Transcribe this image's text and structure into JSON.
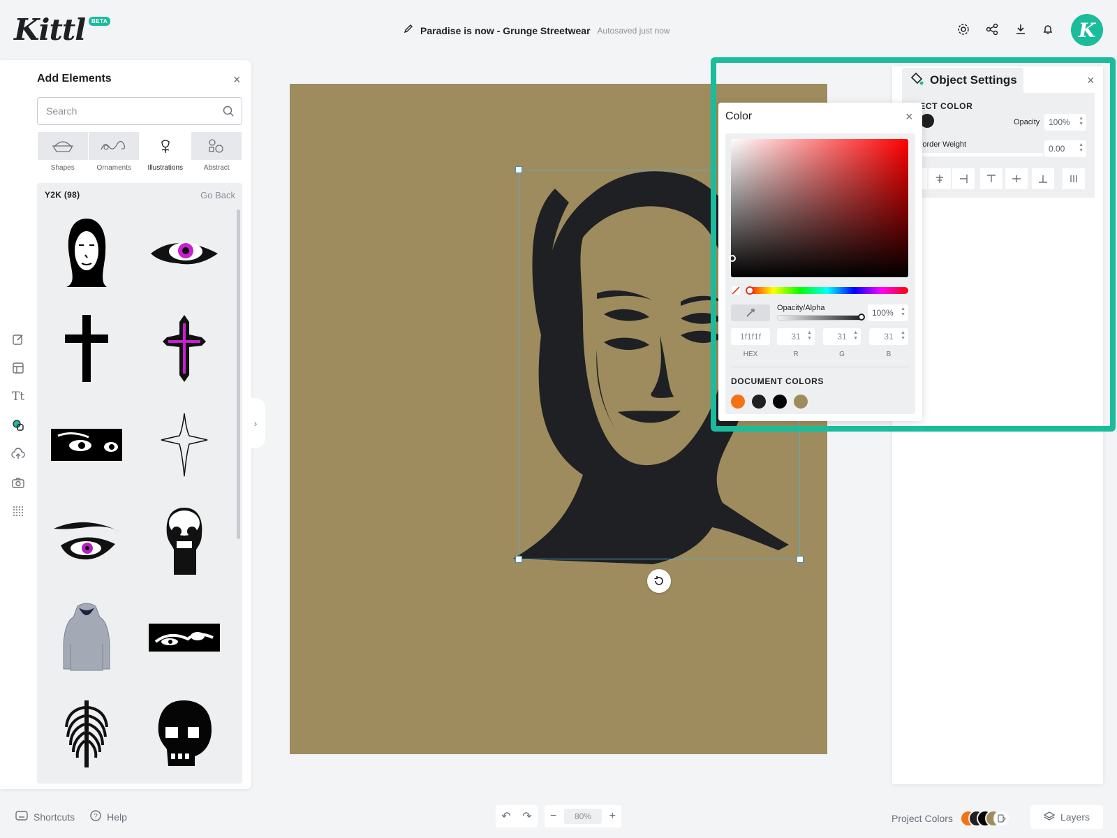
{
  "app": {
    "logo_text": "Kittl",
    "beta_badge": "BETA"
  },
  "header": {
    "doc_title": "Paradise is now - Grunge Streetwear",
    "autosave_status": "Autosaved just now",
    "avatar_letter": "K"
  },
  "elements_panel": {
    "title": "Add Elements",
    "search_placeholder": "Search",
    "categories": [
      "Shapes",
      "Ornaments",
      "Illustrations",
      "Abstract"
    ],
    "active_category": "Illustrations",
    "collection_title": "Y2K (98)",
    "go_back_label": "Go Back",
    "items": [
      "woman-portrait",
      "purple-eye",
      "black-cross",
      "purple-cross",
      "eyes-strip",
      "outline-cross",
      "eye-closeup",
      "skull-bust",
      "hoodie",
      "eye-strip-2",
      "ribcage",
      "pixel-skull"
    ]
  },
  "object_settings": {
    "title": "Object Settings",
    "object_color_label": "JECT COLOR",
    "opacity_label": "Opacity",
    "opacity_value": "100%",
    "border_weight_label": "Border Weight",
    "border_weight_value": "0.00",
    "current_color": "#1f1f1f"
  },
  "color_picker": {
    "title": "Color",
    "opacity_alpha_label": "Opacity/Alpha",
    "opacity_alpha_value": "100%",
    "hex_value": "1f1f1f",
    "r_value": "31",
    "g_value": "31",
    "b_value": "31",
    "hex_label": "HEX",
    "r_label": "R",
    "g_label": "G",
    "b_label": "B",
    "document_colors_label": "DOCUMENT COLORS",
    "document_colors": [
      "#f47216",
      "#1f2024",
      "#050505",
      "#9e8c5e"
    ]
  },
  "bottom_bar": {
    "shortcuts_label": "Shortcuts",
    "help_label": "Help",
    "zoom_value": "80%",
    "project_colors_label": "Project Colors",
    "layers_label": "Layers"
  },
  "colors": {
    "accent": "#1abc9c",
    "artboard": "#9e8c5e",
    "ink": "#1f2024"
  }
}
